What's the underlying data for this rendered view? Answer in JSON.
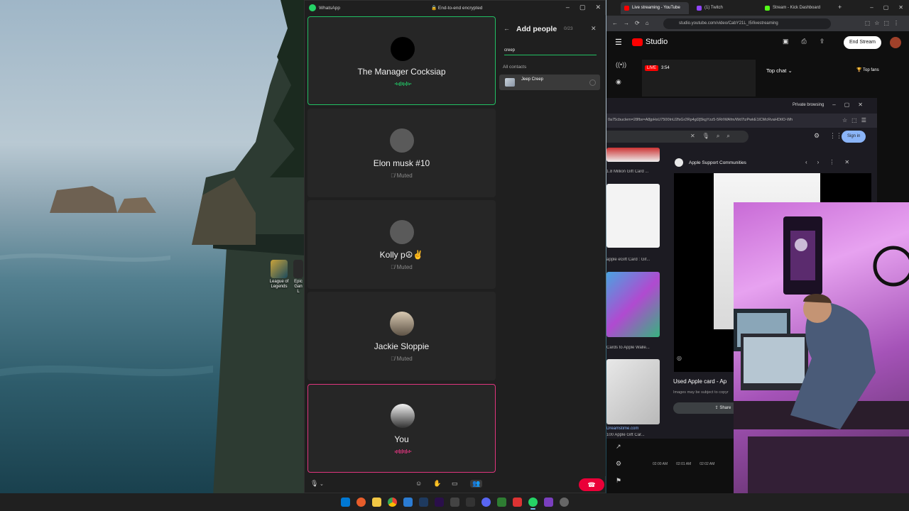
{
  "desktop": {
    "icons": [
      {
        "label": "League of Legends"
      },
      {
        "label": "Epic Gan L"
      }
    ]
  },
  "whatsapp": {
    "app_name": "WhatsApp",
    "encryption": "End-to-end encrypted",
    "participants": [
      {
        "name": "The Manager Cocksiap",
        "status": "",
        "speaking": true
      },
      {
        "name": "Elon musk #10",
        "status": "Muted"
      },
      {
        "name": "Kolly p☮✌",
        "status": "Muted"
      },
      {
        "name": "Jackie Sloppie",
        "status": "Muted"
      },
      {
        "name": "You",
        "status": "",
        "self": true
      }
    ],
    "add_people": {
      "title": "Add people",
      "count": "0/23",
      "search_value": "creep",
      "section_label": "All contacts",
      "contact_name": "Jeep Creep"
    },
    "colors": {
      "speaking": "#21c063",
      "self": "#e0357e",
      "end_call": "#ea0038"
    }
  },
  "browser": {
    "tabs": [
      {
        "label": "Live streaming - YouTube",
        "active": true
      },
      {
        "label": "(1) Twitch"
      },
      {
        "label": "Stream - Kick Dashboard"
      }
    ],
    "url": "studio.youtube.com/video/CabY21L_l5/livestreaming",
    "youtube": {
      "logo_text": "Studio",
      "end_stream": "End Stream",
      "live_badge": "LIVE",
      "live_time": "3:54",
      "chat_mode": "Top chat",
      "top_fans": "Top fans",
      "times": [
        "02:00 AM",
        "02:01 AM",
        "02:02 AM"
      ]
    },
    "private_window": {
      "label": "Private browsing",
      "url": "0a75cbuclem=28fbx=A8jpHsU7500InU2fsGr2Rp4gl2j5kgYzz5-5RrIWAfm/Wd7tzPwkE1lCMcRvaHDtIO-Wh",
      "sign_in": "Sign in",
      "result_title": "Apple Support Communities",
      "thumb_captions": [
        "1.8 Million Gift Card ...",
        "apple eGift Card : Gif...",
        "Cards to Apple Walle...",
        "100 Apple Gift Car..."
      ],
      "thumb_source": "Dreamstime.com",
      "image_caption": "Used Apple card - Ap",
      "image_sub": "Images may be subject to copyr",
      "share": "Share"
    }
  }
}
